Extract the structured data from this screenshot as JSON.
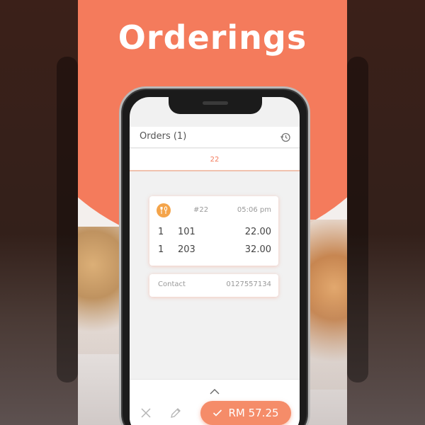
{
  "poster": {
    "headline": "Orderings"
  },
  "app": {
    "title": "Orders (1)",
    "tab_label": "22"
  },
  "order": {
    "number": "#22",
    "time": "05:06 pm",
    "items": [
      {
        "qty": "1",
        "code": "101",
        "price": "22.00"
      },
      {
        "qty": "1",
        "code": "203",
        "price": "32.00"
      }
    ]
  },
  "contact": {
    "label": "Contact",
    "value": "0127557134"
  },
  "actions": {
    "total_label": "RM 57.25"
  },
  "icons": {
    "history": "history-icon",
    "dine": "fork-spoon-icon",
    "chevron": "chevron-up-icon",
    "cancel": "close-icon",
    "edit": "pencil-icon",
    "confirm": "check-icon"
  },
  "colors": {
    "brand": "#f47b5c",
    "button": "#f58c69",
    "dine_icon": "#f4a44a"
  }
}
